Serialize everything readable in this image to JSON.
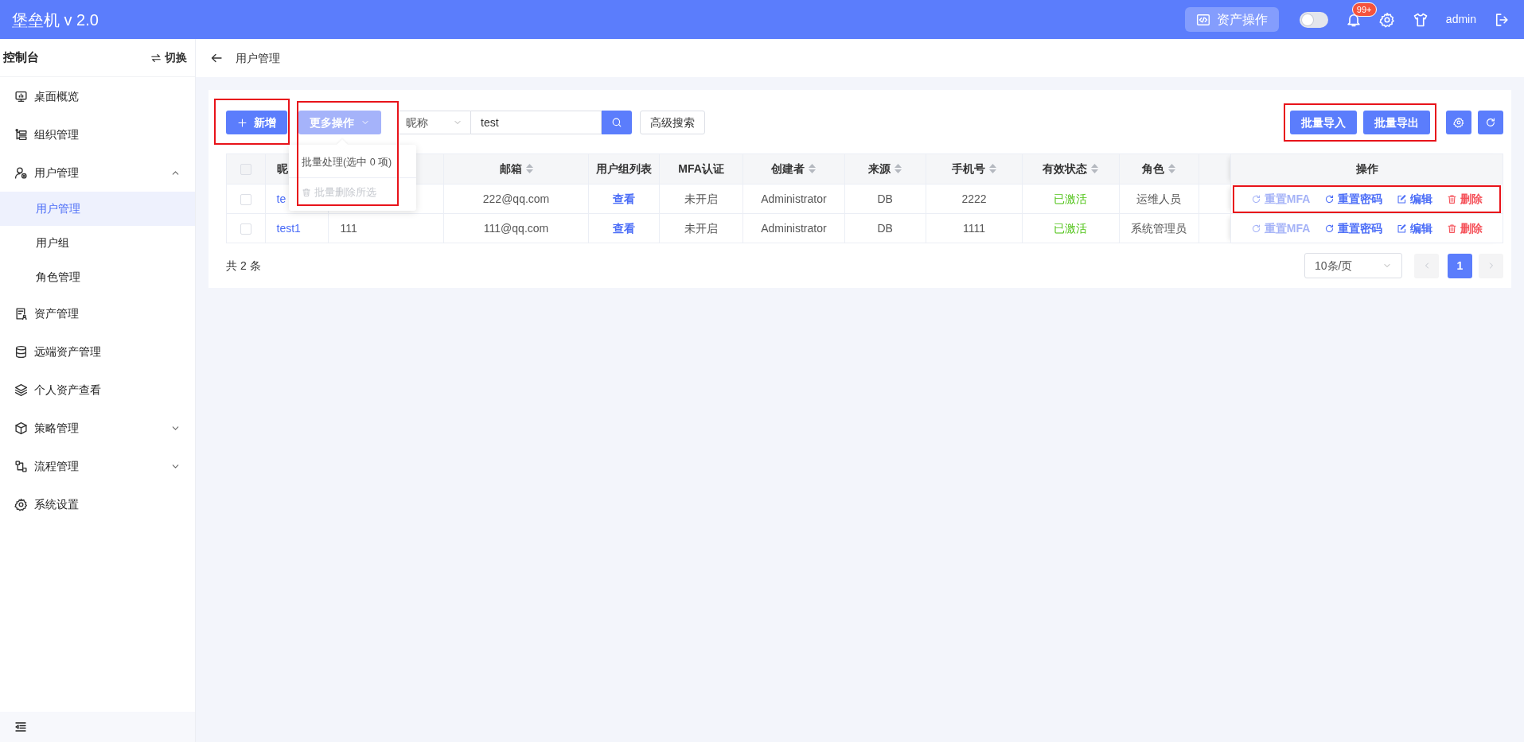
{
  "header": {
    "title": "堡垒机 v 2.0",
    "asset_button": "资产操作",
    "theme_switch": {
      "on": false
    },
    "notification_badge": "99+",
    "user": "admin"
  },
  "sidebar": {
    "title": "控制台",
    "switch_label": "切换",
    "items": [
      {
        "label": "桌面概览",
        "kind": "monitor"
      },
      {
        "label": "组织管理",
        "kind": "hierarchy"
      },
      {
        "label": "用户管理",
        "kind": "user",
        "expanded": true,
        "children": [
          {
            "label": "用户管理",
            "selected": true
          },
          {
            "label": "用户组",
            "selected": false
          },
          {
            "label": "角色管理",
            "selected": false
          }
        ]
      },
      {
        "label": "资产管理",
        "kind": "document"
      },
      {
        "label": "远端资产管理",
        "kind": "database"
      },
      {
        "label": "个人资产查看",
        "kind": "layers"
      },
      {
        "label": "策略管理",
        "kind": "cube",
        "expanded": false
      },
      {
        "label": "流程管理",
        "kind": "flowchart",
        "expanded": false
      },
      {
        "label": "系统设置",
        "kind": "settings"
      }
    ]
  },
  "breadcrumb": {
    "title": "用户管理"
  },
  "toolbar": {
    "new_button": {
      "label": "新增",
      "annotated": true
    },
    "more_button": {
      "label": "更多操作",
      "annotated": true,
      "expanded": true,
      "menu": [
        {
          "label": "批量处理(选中 0 项)",
          "disabled": false
        },
        {
          "label": "批量删除所选",
          "disabled": true
        }
      ]
    },
    "search": {
      "field_label": "昵称",
      "value": "test"
    },
    "advanced_search": "高级搜索",
    "batch_buttons": {
      "annotated": true,
      "items": [
        "批量导入",
        "批量导出"
      ]
    }
  },
  "table": {
    "header_checkbox": {
      "checked": false
    },
    "columns": [
      {
        "label": "昵",
        "sortable": false
      },
      {
        "label": "邮箱",
        "sortable": true
      },
      {
        "label": "用户组列表",
        "sortable": false
      },
      {
        "label": "MFA认证",
        "sortable": false
      },
      {
        "label": "创建者",
        "sortable": true
      },
      {
        "label": "来源",
        "sortable": true
      },
      {
        "label": "手机号",
        "sortable": true
      },
      {
        "label": "有效状态",
        "sortable": true
      },
      {
        "label": "角色",
        "sortable": true
      },
      {
        "label": "操作",
        "sortable": false
      }
    ],
    "rows": [
      {
        "checked": false,
        "username": "te",
        "email": "222@qq.com",
        "groups": "查看",
        "mfa": "未开启",
        "creator": "Administrator",
        "source": "DB",
        "phone": "2222",
        "status": "已激活",
        "role": "运维人员",
        "annotated": true,
        "actions": [
          {
            "kind": "reset-mfa",
            "label": "重置MFA",
            "disabled": true
          },
          {
            "kind": "reset-password",
            "label": "重置密码",
            "disabled": false
          },
          {
            "kind": "edit",
            "label": "编辑",
            "disabled": false
          },
          {
            "kind": "delete",
            "label": "删除",
            "disabled": false
          }
        ]
      },
      {
        "checked": false,
        "username": "test1",
        "nickname": "111",
        "email": "111@qq.com",
        "groups": "查看",
        "mfa": "未开启",
        "creator": "Administrator",
        "source": "DB",
        "phone": "1111",
        "status": "已激活",
        "role": "系统管理员",
        "annotated": false,
        "actions": [
          {
            "kind": "reset-mfa",
            "label": "重置MFA",
            "disabled": true
          },
          {
            "kind": "reset-password",
            "label": "重置密码",
            "disabled": false
          },
          {
            "kind": "edit",
            "label": "编辑",
            "disabled": false
          },
          {
            "kind": "delete",
            "label": "删除",
            "disabled": false
          }
        ]
      }
    ]
  },
  "footer": {
    "total": "共 2 条",
    "page_size": "10条/页",
    "prev_disabled": true,
    "next_disabled": true,
    "pages": [
      {
        "label": "1",
        "selected": true
      }
    ]
  }
}
